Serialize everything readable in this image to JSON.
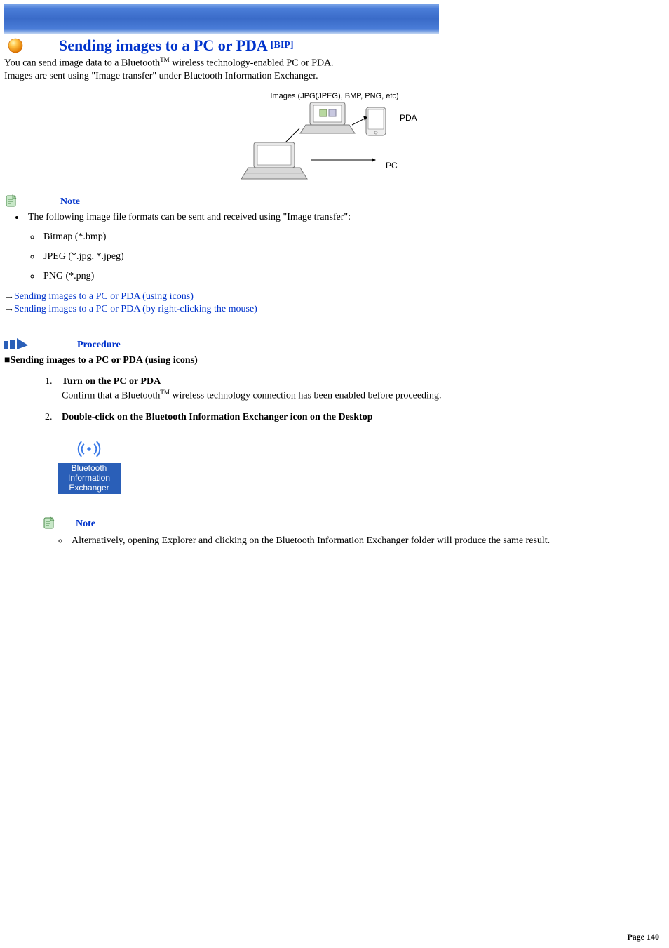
{
  "header": {
    "title": "Sending images to a PC or PDA",
    "suffix": "[BIP]"
  },
  "intro": {
    "line1_pre": "You can send image data to a Bluetooth",
    "tm": "TM",
    "line1_post": " wireless technology-enabled PC or PDA.",
    "line2": "Images are sent using \"Image transfer\" under Bluetooth Information Exchanger."
  },
  "diagram": {
    "caption": "Images (JPG(JPEG), BMP, PNG, etc)",
    "pda_label": "PDA",
    "pc_label": "PC"
  },
  "note1": {
    "label": "Note",
    "intro": "The following image file formats can be sent and received using \"Image transfer\":",
    "formats": [
      "Bitmap (*.bmp)",
      "JPEG (*.jpg, *.jpeg)",
      "PNG (*.png)"
    ]
  },
  "links": {
    "arrow": "→",
    "l1": "Sending images to a PC or PDA (using icons)",
    "l2": "Sending images to a PC or PDA (by right-clicking the mouse)"
  },
  "procedure": {
    "label": "Procedure",
    "subheading": "■Sending images to a PC or PDA (using icons)",
    "steps": {
      "s1": {
        "title": "Turn on the PC or PDA",
        "desc_pre": "Confirm that a Bluetooth",
        "tm": "TM",
        "desc_post": " wireless technology connection has been enabled before proceeding."
      },
      "s2": {
        "title": "Double-click on the Bluetooth Information Exchanger icon on the Desktop"
      }
    },
    "desktop_icon_label": "Bluetooth Information Exchanger",
    "note2": {
      "label": "Note",
      "text": "Alternatively, opening Explorer and clicking on the Bluetooth Information Exchanger folder will produce the same result."
    }
  },
  "footer": {
    "page_label": "Page 140"
  }
}
